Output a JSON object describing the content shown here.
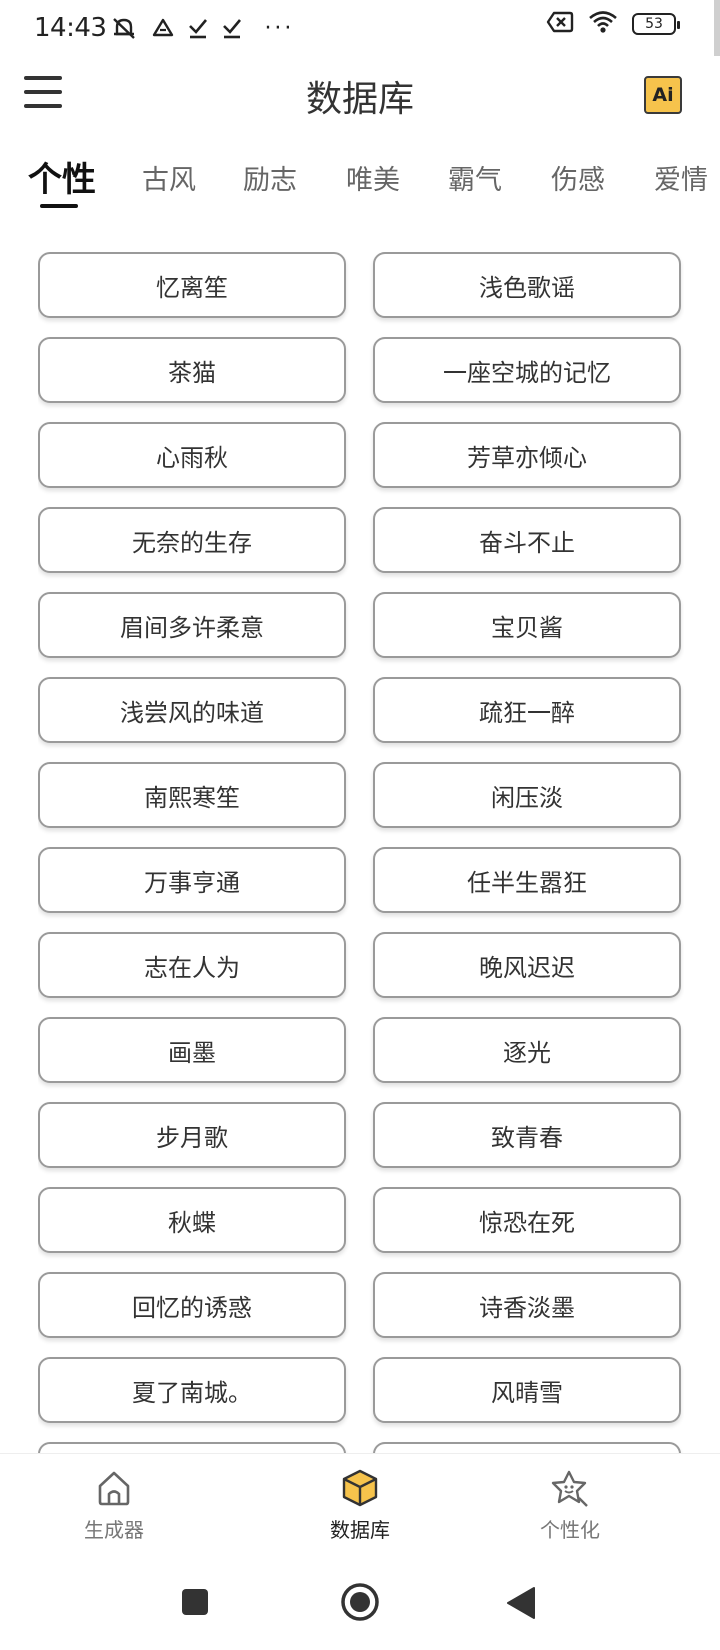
{
  "status_bar": {
    "time": "14:43",
    "more_dots": "···",
    "battery_level": "53",
    "icons": [
      "mute-notifications-icon",
      "drive-icon",
      "download-check-icon",
      "download-check-icon",
      "sim-off-icon",
      "wifi-icon",
      "battery-icon"
    ]
  },
  "app_bar": {
    "title": "数据库",
    "ai_label": "Ai"
  },
  "tabs": [
    {
      "label": "个性",
      "active": true
    },
    {
      "label": "古风",
      "active": false
    },
    {
      "label": "励志",
      "active": false
    },
    {
      "label": "唯美",
      "active": false
    },
    {
      "label": "霸气",
      "active": false
    },
    {
      "label": "伤感",
      "active": false
    },
    {
      "label": "爱情",
      "active": false
    }
  ],
  "items": [
    [
      "忆离笙",
      "浅色歌谣"
    ],
    [
      "茶猫",
      "一座空城的记忆"
    ],
    [
      "心雨秋",
      "芳草亦倾心"
    ],
    [
      "无奈的生存",
      "奋斗不止"
    ],
    [
      "眉间多许柔意",
      "宝贝酱"
    ],
    [
      "浅尝风的味道",
      "疏狂一醉"
    ],
    [
      "南熙寒笙",
      "闲压淡"
    ],
    [
      "万事亨通",
      "任半生嚣狂"
    ],
    [
      "志在人为",
      "晚风迟迟"
    ],
    [
      "画墨",
      "逐光"
    ],
    [
      "步月歌",
      "致青春"
    ],
    [
      "秋蝶",
      "惊恐在死"
    ],
    [
      "回忆的诱惑",
      "诗香淡墨"
    ],
    [
      "夏了南城。",
      "风晴雪"
    ],
    [
      "",
      ""
    ]
  ],
  "bottom_nav": [
    {
      "label": "生成器",
      "icon": "home-icon",
      "active": false
    },
    {
      "label": "数据库",
      "icon": "box-icon",
      "active": true
    },
    {
      "label": "个性化",
      "icon": "star-icon",
      "active": false
    }
  ],
  "colors": {
    "accent": "#f6c34c",
    "text": "#333333",
    "muted": "#777777",
    "border": "#9a9a9a"
  }
}
